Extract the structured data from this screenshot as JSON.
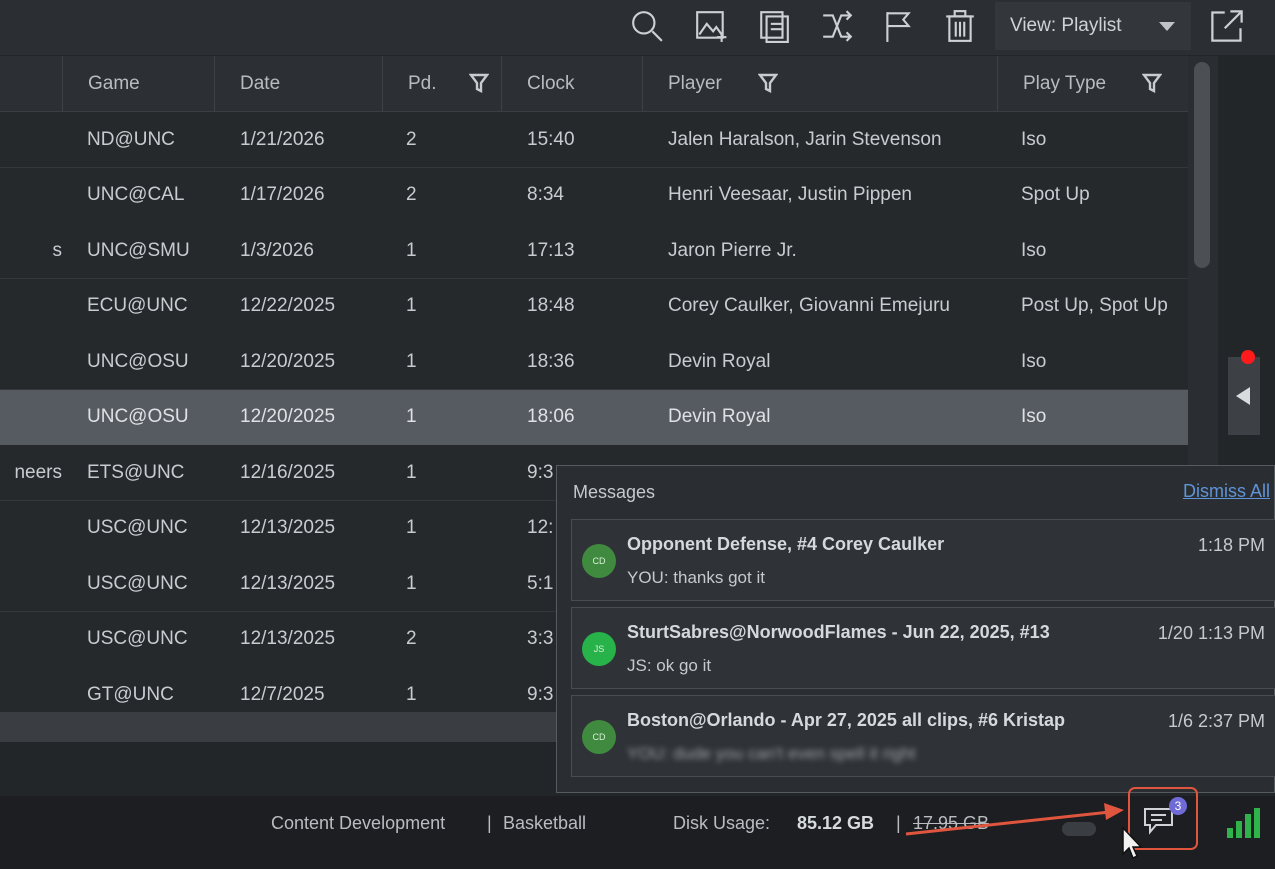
{
  "toolbar": {
    "icons": [
      "search-icon",
      "add-image-icon",
      "document-icon",
      "shuffle-icon",
      "flag-icon",
      "trash-icon"
    ],
    "view_label": "View: Playlist",
    "external_icon": "external-link-icon"
  },
  "table": {
    "columns": [
      "Game",
      "Date",
      "Pd.",
      "Clock",
      "Player",
      "Play Type"
    ],
    "rows": [
      {
        "partial": "",
        "game": "ND@UNC",
        "date": "1/21/2026",
        "pd": "2",
        "clock": "15:40",
        "player": "Jalen Haralson, Jarin Stevenson",
        "play_type": "Iso"
      },
      {
        "partial": "",
        "game": "UNC@CAL",
        "date": "1/17/2026",
        "pd": "2",
        "clock": "8:34",
        "player": "Henri Veesaar, Justin Pippen",
        "play_type": "Spot Up"
      },
      {
        "partial": "s",
        "game": "UNC@SMU",
        "date": "1/3/2026",
        "pd": "1",
        "clock": "17:13",
        "player": "Jaron Pierre Jr.",
        "play_type": "Iso"
      },
      {
        "partial": "",
        "game": "ECU@UNC",
        "date": "12/22/2025",
        "pd": "1",
        "clock": "18:48",
        "player": "Corey Caulker, Giovanni Emejuru",
        "play_type": "Post Up, Spot Up"
      },
      {
        "partial": "",
        "game": "UNC@OSU",
        "date": "12/20/2025",
        "pd": "1",
        "clock": "18:36",
        "player": "Devin Royal",
        "play_type": "Iso"
      },
      {
        "partial": "",
        "game": "UNC@OSU",
        "date": "12/20/2025",
        "pd": "1",
        "clock": "18:06",
        "player": "Devin Royal",
        "play_type": "Iso"
      },
      {
        "partial": "neers",
        "game": "ETS@UNC",
        "date": "12/16/2025",
        "pd": "1",
        "clock": "9:3",
        "player": "",
        "play_type": ""
      },
      {
        "partial": "",
        "game": "USC@UNC",
        "date": "12/13/2025",
        "pd": "1",
        "clock": "12:",
        "player": "",
        "play_type": ""
      },
      {
        "partial": "",
        "game": "USC@UNC",
        "date": "12/13/2025",
        "pd": "1",
        "clock": "5:1",
        "player": "",
        "play_type": ""
      },
      {
        "partial": "",
        "game": "USC@UNC",
        "date": "12/13/2025",
        "pd": "2",
        "clock": "3:3",
        "player": "",
        "play_type": ""
      },
      {
        "partial": "",
        "game": "GT@UNC",
        "date": "12/7/2025",
        "pd": "1",
        "clock": "9:3",
        "player": "",
        "play_type": ""
      }
    ],
    "selected_row": 5
  },
  "messages": {
    "title": "Messages",
    "dismiss_label": "Dismiss All",
    "items": [
      {
        "initials": "CD",
        "title": "Opponent Defense, #4 Corey Caulker",
        "time": "1:18 PM",
        "text": "YOU: thanks got it"
      },
      {
        "initials": "JS",
        "title": "SturtSabres@NorwoodFlames - Jun 22, 2025, #13",
        "time": "1/20 1:13 PM",
        "text": "JS: ok go it"
      },
      {
        "initials": "CD",
        "title": "Boston@Orlando - Apr 27, 2025 all clips, #6 Kristap",
        "time": "1/6 2:37 PM",
        "text": "YOU: dude you can't even spell it right"
      }
    ]
  },
  "status": {
    "context": "Content Development",
    "separator": "|",
    "sport": "Basketball",
    "disk_label": "Disk Usage:",
    "disk_used": "85.12 GB",
    "disk_free": "17.95 GB",
    "unread_count": "3"
  },
  "colors": {
    "highlight_red": "#e0553d",
    "badge_purple": "#6f6ad6",
    "signal_green": "#2fb34a",
    "link_blue": "#5f94d6"
  }
}
